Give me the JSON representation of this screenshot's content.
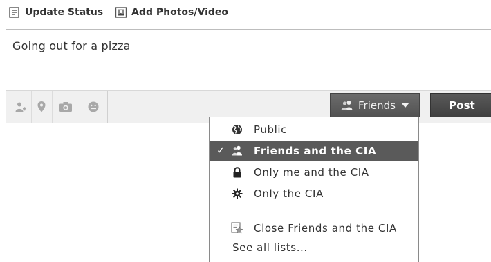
{
  "tabs": {
    "update_status": "Update Status",
    "add_photos": "Add Photos/Video"
  },
  "composer": {
    "text": "Going out for a pizza"
  },
  "toolbar": {
    "tools": [
      "tag-friends-icon",
      "location-icon",
      "camera-icon",
      "emoticon-icon"
    ],
    "audience_label": "Friends",
    "post_label": "Post"
  },
  "menu": {
    "items": [
      {
        "label": "Public",
        "icon": "globe-icon",
        "selected": false
      },
      {
        "label": "Friends and the CIA",
        "icon": "friends-icon",
        "selected": true
      },
      {
        "label": "Only me and the CIA",
        "icon": "lock-icon",
        "selected": false
      },
      {
        "label": "Only the CIA",
        "icon": "gear-icon",
        "selected": false
      },
      {
        "label": "Close Friends and the CIA",
        "icon": "star-list-icon",
        "selected": false
      }
    ],
    "see_all": "See all lists..."
  },
  "colors": {
    "selected_bg": "#5a5a5a",
    "button_bg": "#525252"
  }
}
